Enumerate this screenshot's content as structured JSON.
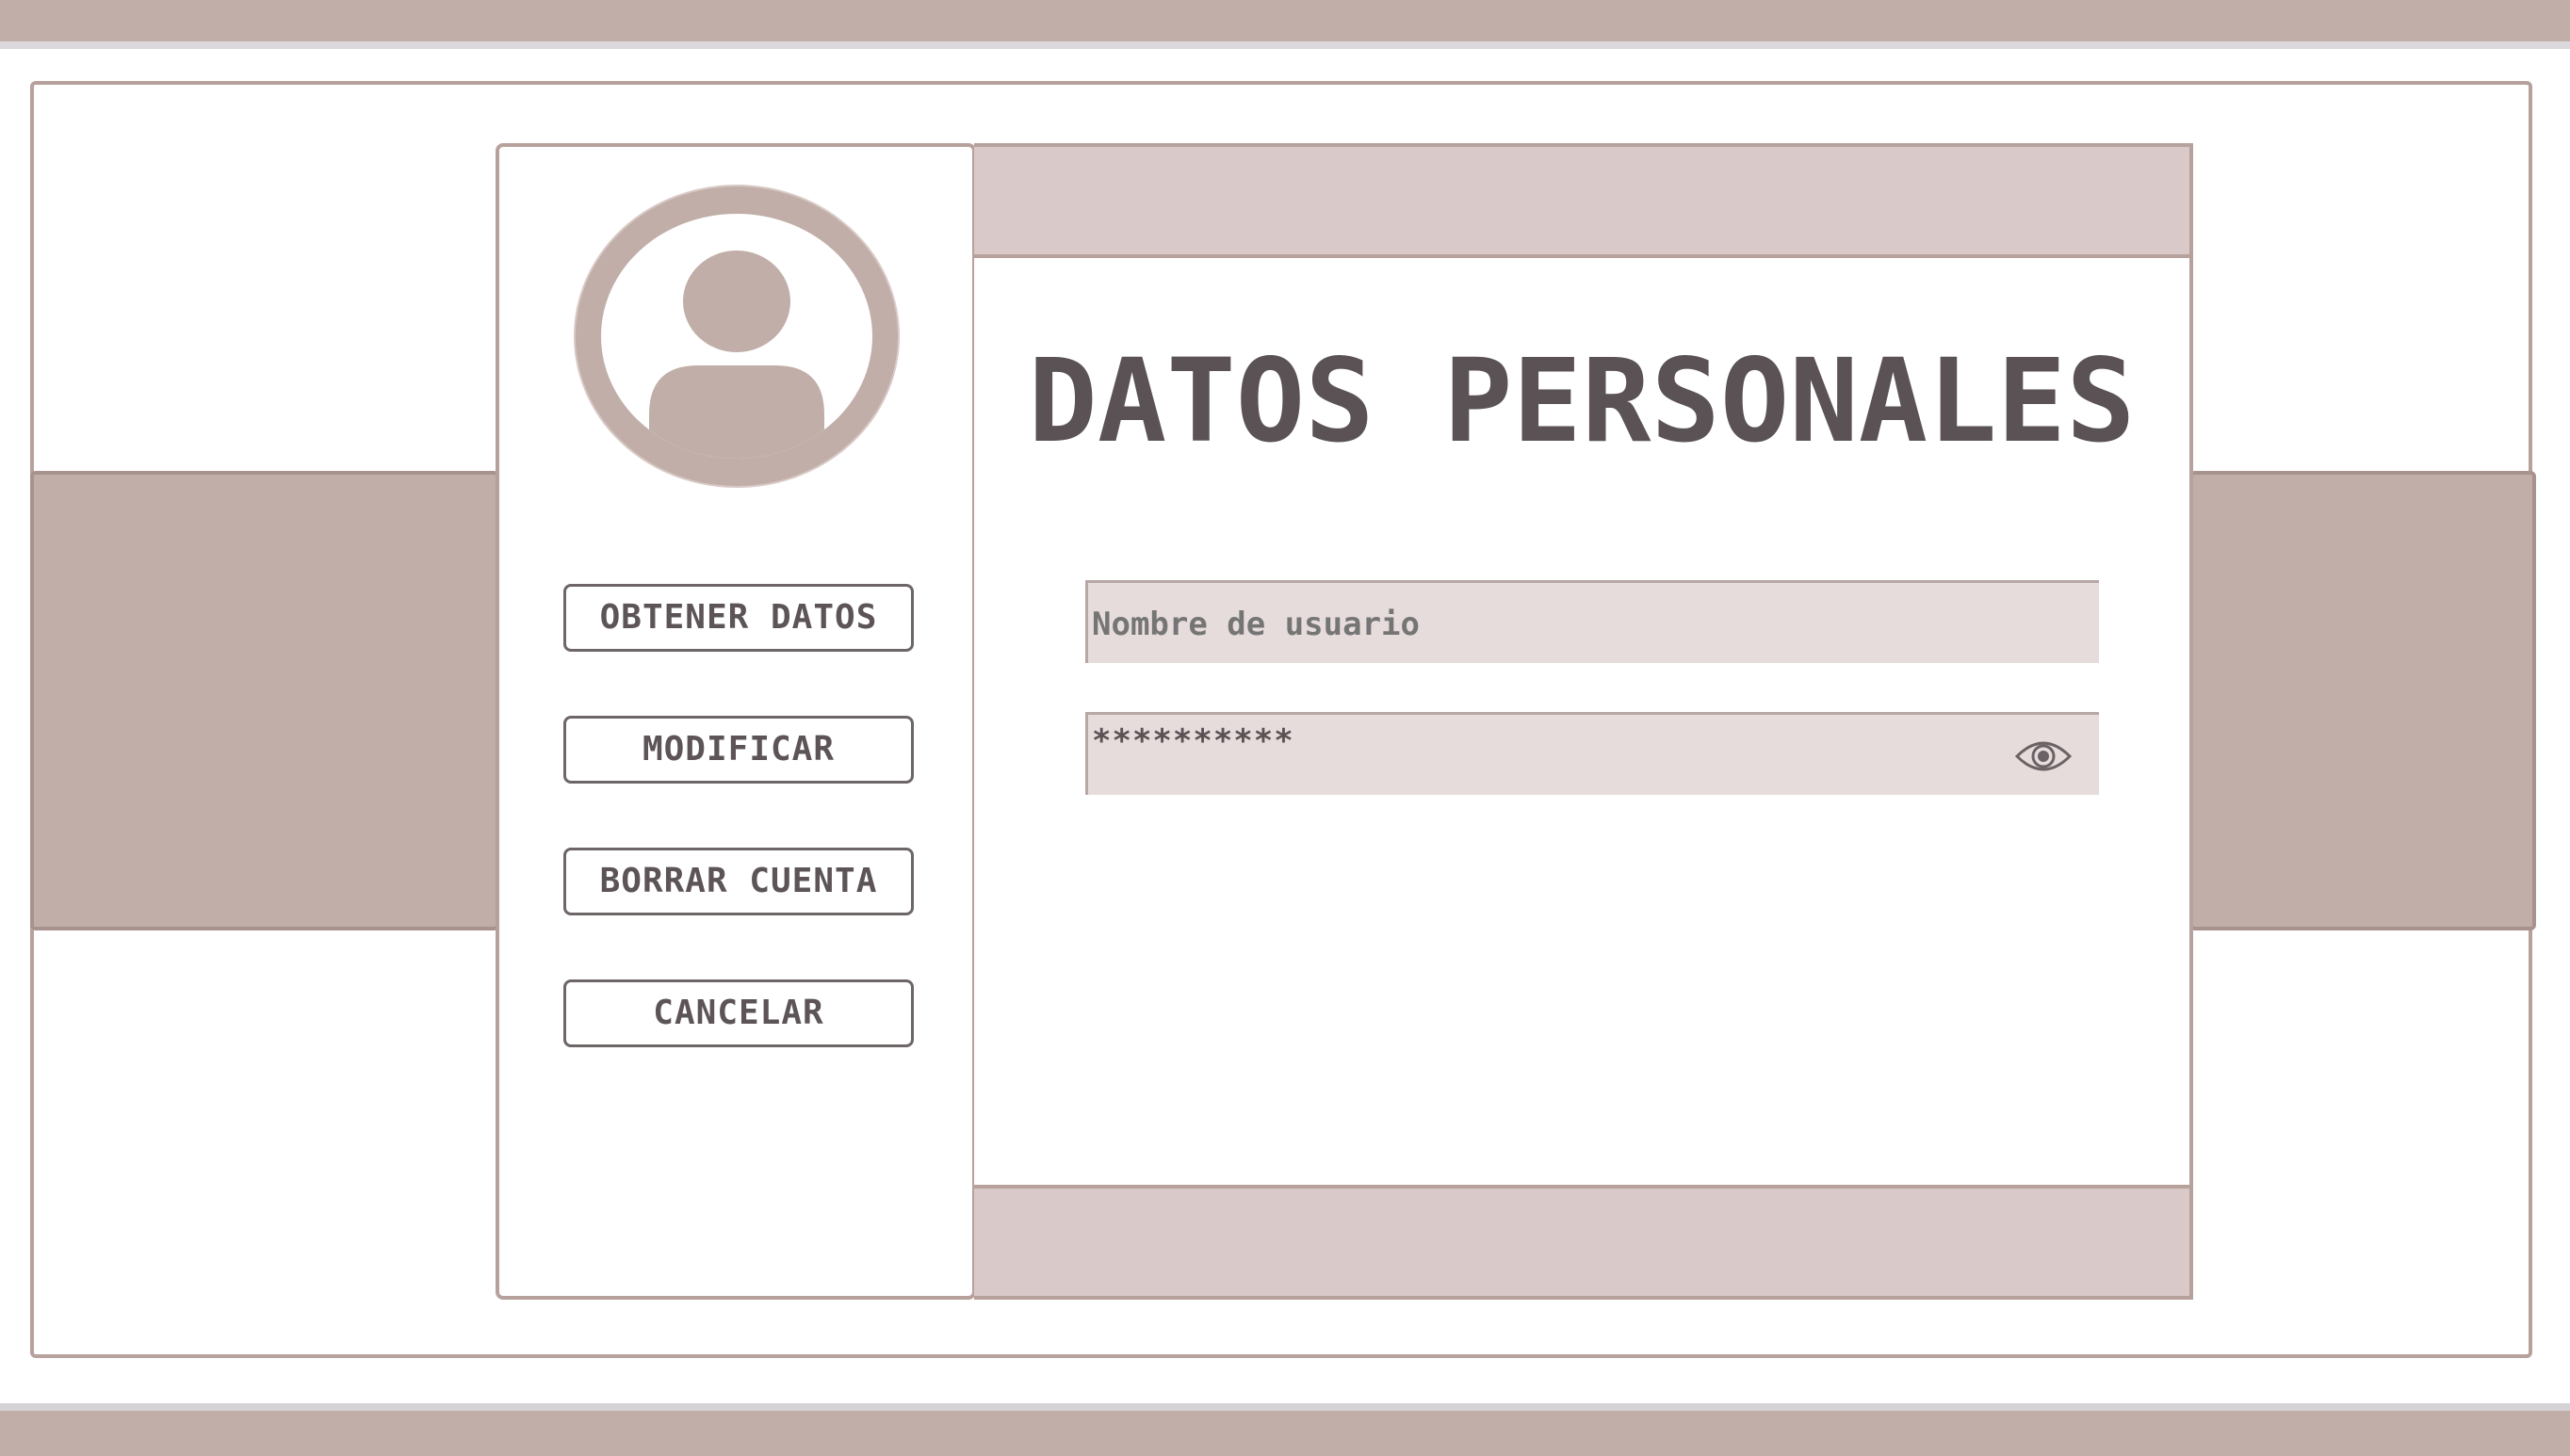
{
  "colors": {
    "accent": "#c1aea8",
    "panel_band": "#dac9c9",
    "field_bg": "#e6dcdb",
    "border": "#b7a19c",
    "text": "#5a5254"
  },
  "sidebar": {
    "avatar_icon": "user-avatar-icon",
    "buttons": [
      {
        "label": "OBTENER DATOS"
      },
      {
        "label": "MODIFICAR"
      },
      {
        "label": "BORRAR CUENTA"
      },
      {
        "label": "CANCELAR"
      }
    ]
  },
  "main": {
    "title": "DATOS PERSONALES",
    "username_field": {
      "placeholder": "Nombre de usuario",
      "value": ""
    },
    "password_field": {
      "value": "**********",
      "toggle_icon": "eye-icon"
    }
  }
}
